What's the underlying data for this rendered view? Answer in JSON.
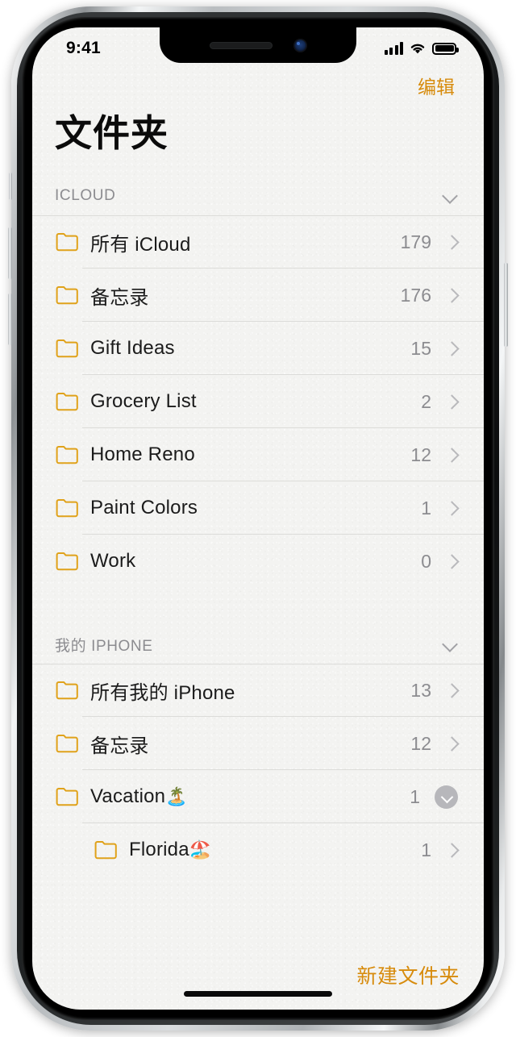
{
  "statusbar": {
    "time": "9:41",
    "signal_icon": "cellular-signal-icon",
    "wifi_icon": "wifi-icon",
    "battery_icon": "battery-icon"
  },
  "nav": {
    "edit_label": "编辑"
  },
  "header": {
    "title": "文件夹"
  },
  "accent_color": "#d78b0c",
  "sections": [
    {
      "id": "icloud",
      "label": "ICLOUD",
      "collapse_icon": "chevron-down-icon",
      "rows": [
        {
          "label": "所有 iCloud",
          "count": "179",
          "accessory": "chevron-right-icon",
          "indent": false
        },
        {
          "label": "备忘录",
          "count": "176",
          "accessory": "chevron-right-icon",
          "indent": false
        },
        {
          "label": "Gift Ideas",
          "count": "15",
          "accessory": "chevron-right-icon",
          "indent": false
        },
        {
          "label": "Grocery List",
          "count": "2",
          "accessory": "chevron-right-icon",
          "indent": false
        },
        {
          "label": "Home Reno",
          "count": "12",
          "accessory": "chevron-right-icon",
          "indent": false
        },
        {
          "label": "Paint Colors",
          "count": "1",
          "accessory": "chevron-right-icon",
          "indent": false
        },
        {
          "label": "Work",
          "count": "0",
          "accessory": "chevron-right-icon",
          "indent": false
        }
      ]
    },
    {
      "id": "my-iphone",
      "label": "我的 IPHONE",
      "collapse_icon": "chevron-down-icon",
      "rows": [
        {
          "label": "所有我的 iPhone",
          "count": "13",
          "accessory": "chevron-right-icon",
          "indent": false
        },
        {
          "label": "备忘录",
          "count": "12",
          "accessory": "chevron-right-icon",
          "indent": false
        },
        {
          "label": "Vacation",
          "emoji": "🏝️",
          "count": "1",
          "accessory": "circle-chevron-down-icon",
          "indent": false
        },
        {
          "label": "Florida",
          "emoji": "🏖️",
          "count": "1",
          "accessory": "chevron-right-icon",
          "indent": true
        }
      ]
    }
  ],
  "footer": {
    "new_folder_label": "新建文件夹"
  }
}
